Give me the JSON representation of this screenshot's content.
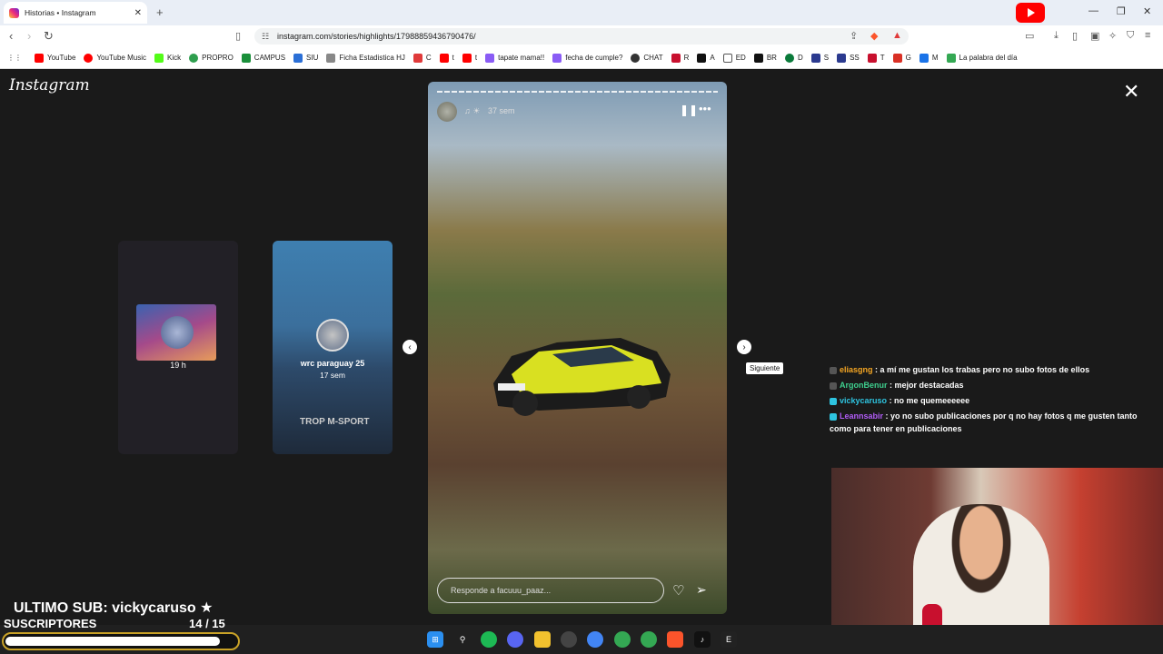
{
  "browser": {
    "tab_title": "Historias • Instagram",
    "url": "instagram.com/stories/highlights/17988859436790476/",
    "bookmarks": [
      {
        "label": "YouTube",
        "color": "#ff0000"
      },
      {
        "label": "YouTube Music",
        "color": "#ff0000"
      },
      {
        "label": "Kick",
        "color": "#53fc18"
      },
      {
        "label": "PROPRO",
        "color": "#2e9e4e"
      },
      {
        "label": "CAMPUS",
        "color": "#1a8f3a"
      },
      {
        "label": "SIU",
        "color": "#2b6fd6"
      },
      {
        "label": "Ficha Estadistica HJ",
        "color": "#888888"
      },
      {
        "label": "C",
        "color": "#e03a3a"
      },
      {
        "label": "t",
        "color": "#ff0000"
      },
      {
        "label": "t",
        "color": "#ff0000"
      },
      {
        "label": "tapate mama!!",
        "color": "#8a5cf5"
      },
      {
        "label": "fecha de cumple?",
        "color": "#8a5cf5"
      },
      {
        "label": "CHAT",
        "color": "#333333"
      },
      {
        "label": "R",
        "color": "#c8102e"
      },
      {
        "label": "A",
        "color": "#111111"
      },
      {
        "label": "ED",
        "color": "#555555"
      },
      {
        "label": "BR",
        "color": "#111111"
      },
      {
        "label": "D",
        "color": "#0a7a3a"
      },
      {
        "label": "S",
        "color": "#2b3a8f"
      },
      {
        "label": "SS",
        "color": "#2b3a8f"
      },
      {
        "label": "T",
        "color": "#c8102e"
      },
      {
        "label": "G",
        "color": "#d93025"
      },
      {
        "label": "M",
        "color": "#1a73e8"
      },
      {
        "label": "La palabra del día",
        "color": "#34a853"
      }
    ]
  },
  "instagram": {
    "logo": "Instagram",
    "prev_story_time": "19 h",
    "card2": {
      "name": "wrc paraguay 25",
      "time": "17 sem",
      "brand_text": "TROP M-SPORT"
    },
    "story": {
      "time": "37 sem",
      "reply_placeholder": "Responde a facuuu_paaz..."
    },
    "next_tooltip": "Siguiente"
  },
  "chat": [
    {
      "user": "eliasgng",
      "message": ": a mí me gustan los trabas pero no subo fotos de ellos"
    },
    {
      "user": "ArgonBenur",
      "message": ": mejor destacadas"
    },
    {
      "user": "vickycaruso",
      "message": ": no me quemeeeeee"
    },
    {
      "user": "Leannsabir",
      "message": ": yo no subo publicaciones por q no hay fotos q me gusten tanto como para tener en publicaciones"
    }
  ],
  "subs": {
    "last_sub": "ULTIMO SUB: vickycaruso ★",
    "label": "SUSCRIPTORES",
    "count": "14  / 15",
    "progress": 0.93
  }
}
